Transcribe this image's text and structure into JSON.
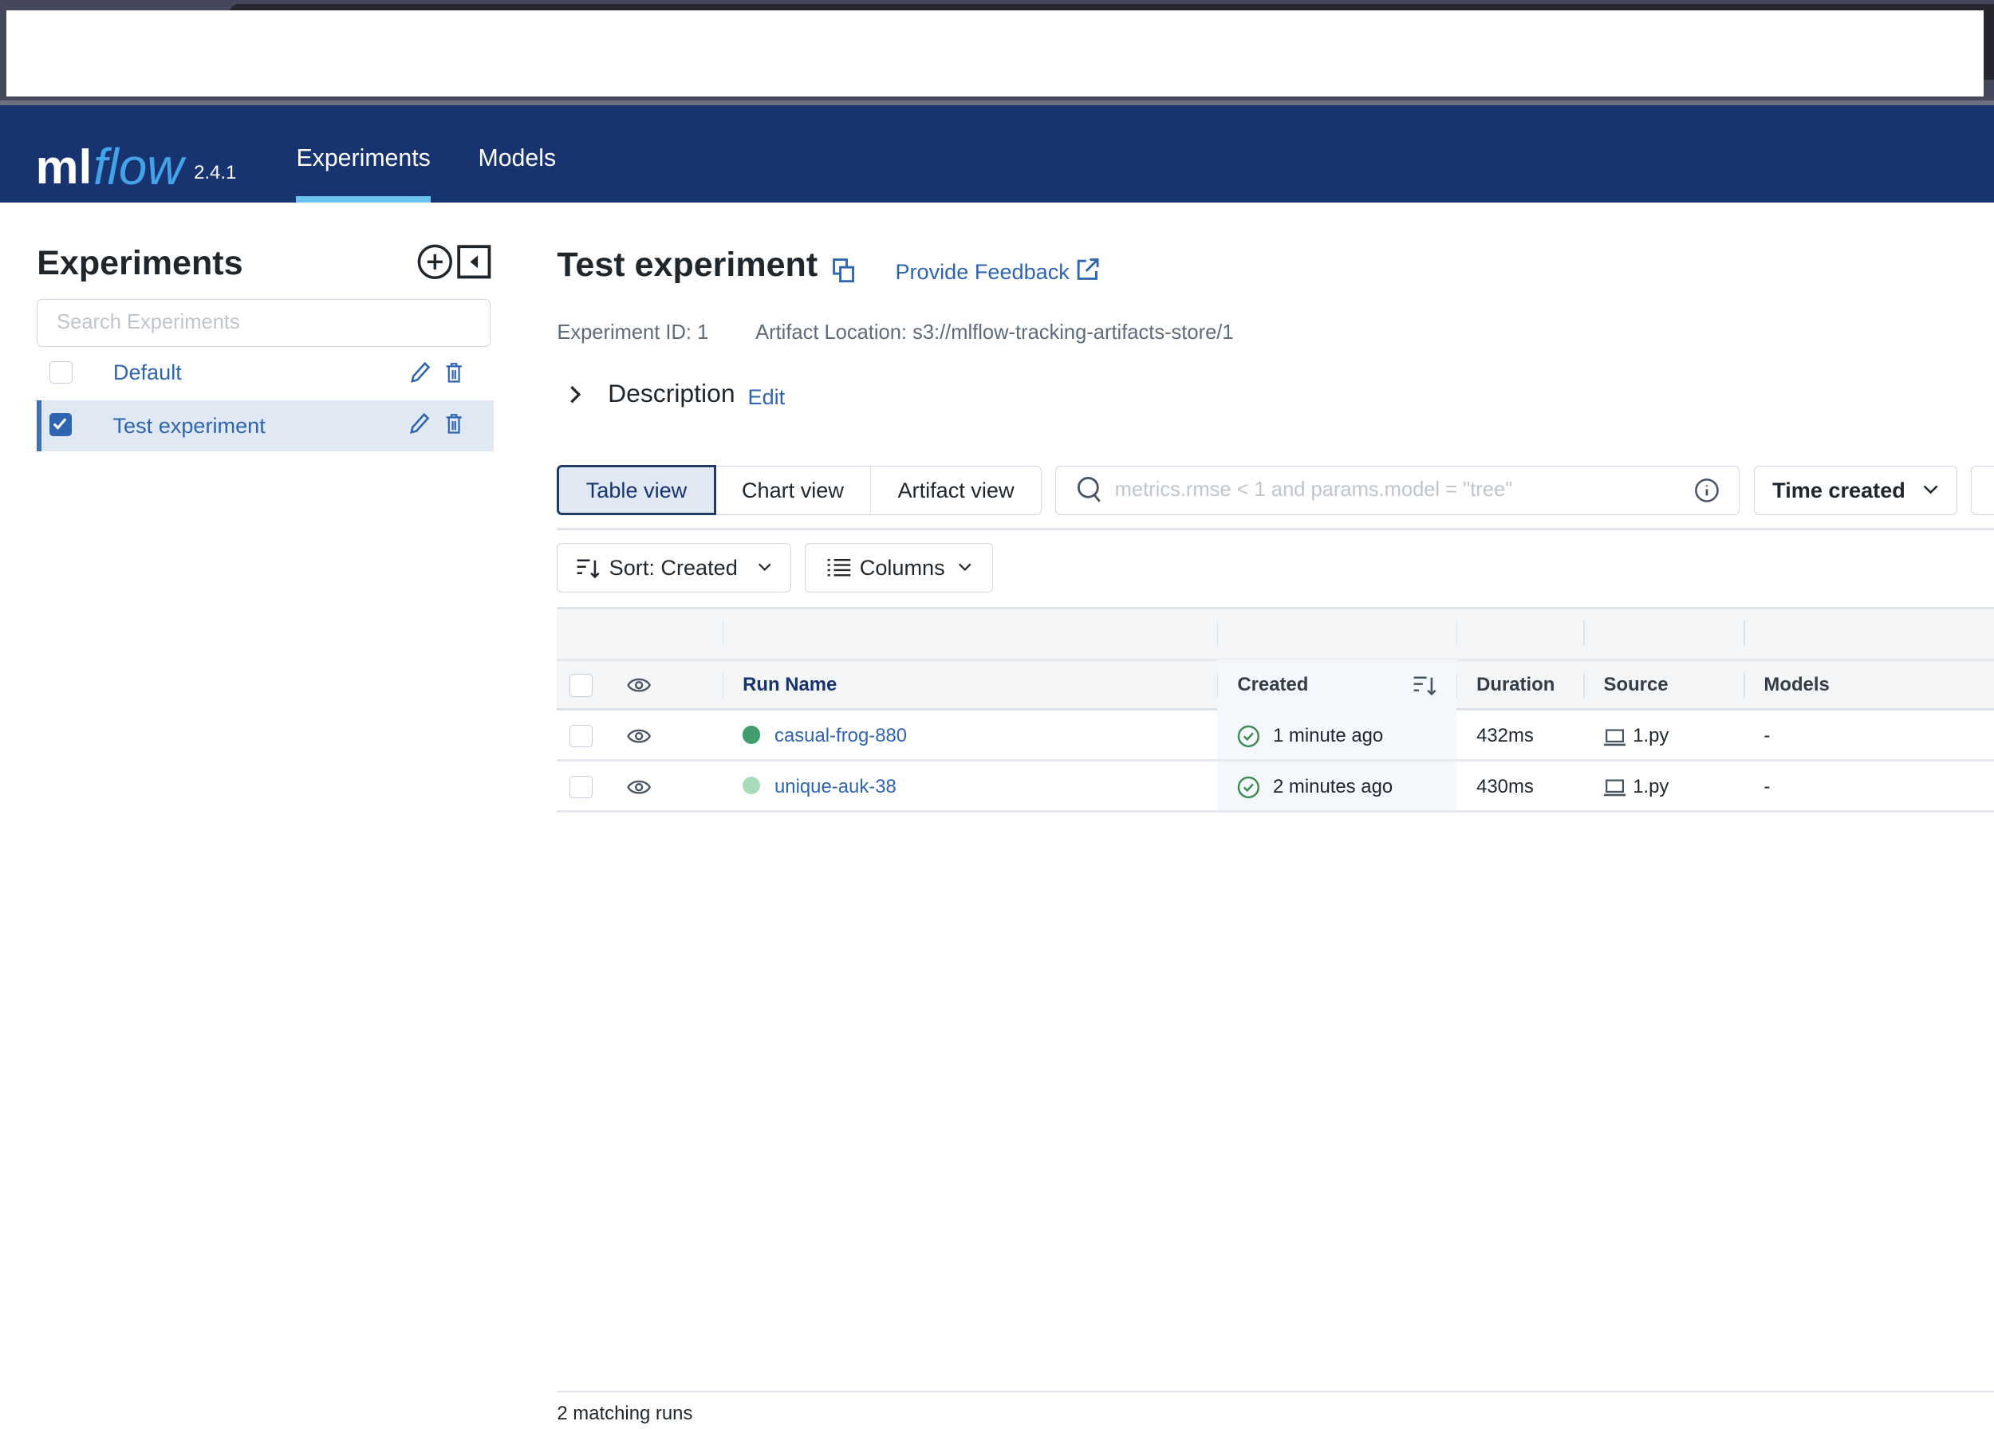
{
  "nav": {
    "logo_ml": "ml",
    "logo_flow": "flow",
    "version": "2.4.1",
    "items": [
      {
        "label": "Experiments",
        "active": true
      },
      {
        "label": "Models",
        "active": false
      }
    ]
  },
  "sidebar": {
    "title": "Experiments",
    "search_placeholder": "Search Experiments",
    "experiments": [
      {
        "name": "Default",
        "checked": false
      },
      {
        "name": "Test experiment",
        "checked": true
      }
    ]
  },
  "main": {
    "title": "Test experiment",
    "feedback": "Provide Feedback",
    "experiment_id": "Experiment ID: 1",
    "artifact_location": "Artifact Location: s3://mlflow-tracking-artifacts-store/1",
    "description_label": "Description",
    "description_edit": "Edit",
    "views": [
      "Table view",
      "Chart view",
      "Artifact view"
    ],
    "search_placeholder": "metrics.rmse < 1 and params.model = \"tree\"",
    "time_filter": "Time created",
    "sort_label": "Sort: Created",
    "columns_label": "Columns",
    "table": {
      "headers": {
        "run_name": "Run Name",
        "created": "Created",
        "duration": "Duration",
        "source": "Source",
        "models": "Models"
      },
      "rows": [
        {
          "run_name": "casual-frog-880",
          "color": "#3f9e6b",
          "created": "1 minute ago",
          "duration": "432ms",
          "source": "1.py",
          "models": "-"
        },
        {
          "run_name": "unique-auk-38",
          "color": "#a8dbb9",
          "created": "2 minutes ago",
          "duration": "430ms",
          "source": "1.py",
          "models": "-"
        }
      ]
    },
    "footer": "2 matching runs"
  }
}
